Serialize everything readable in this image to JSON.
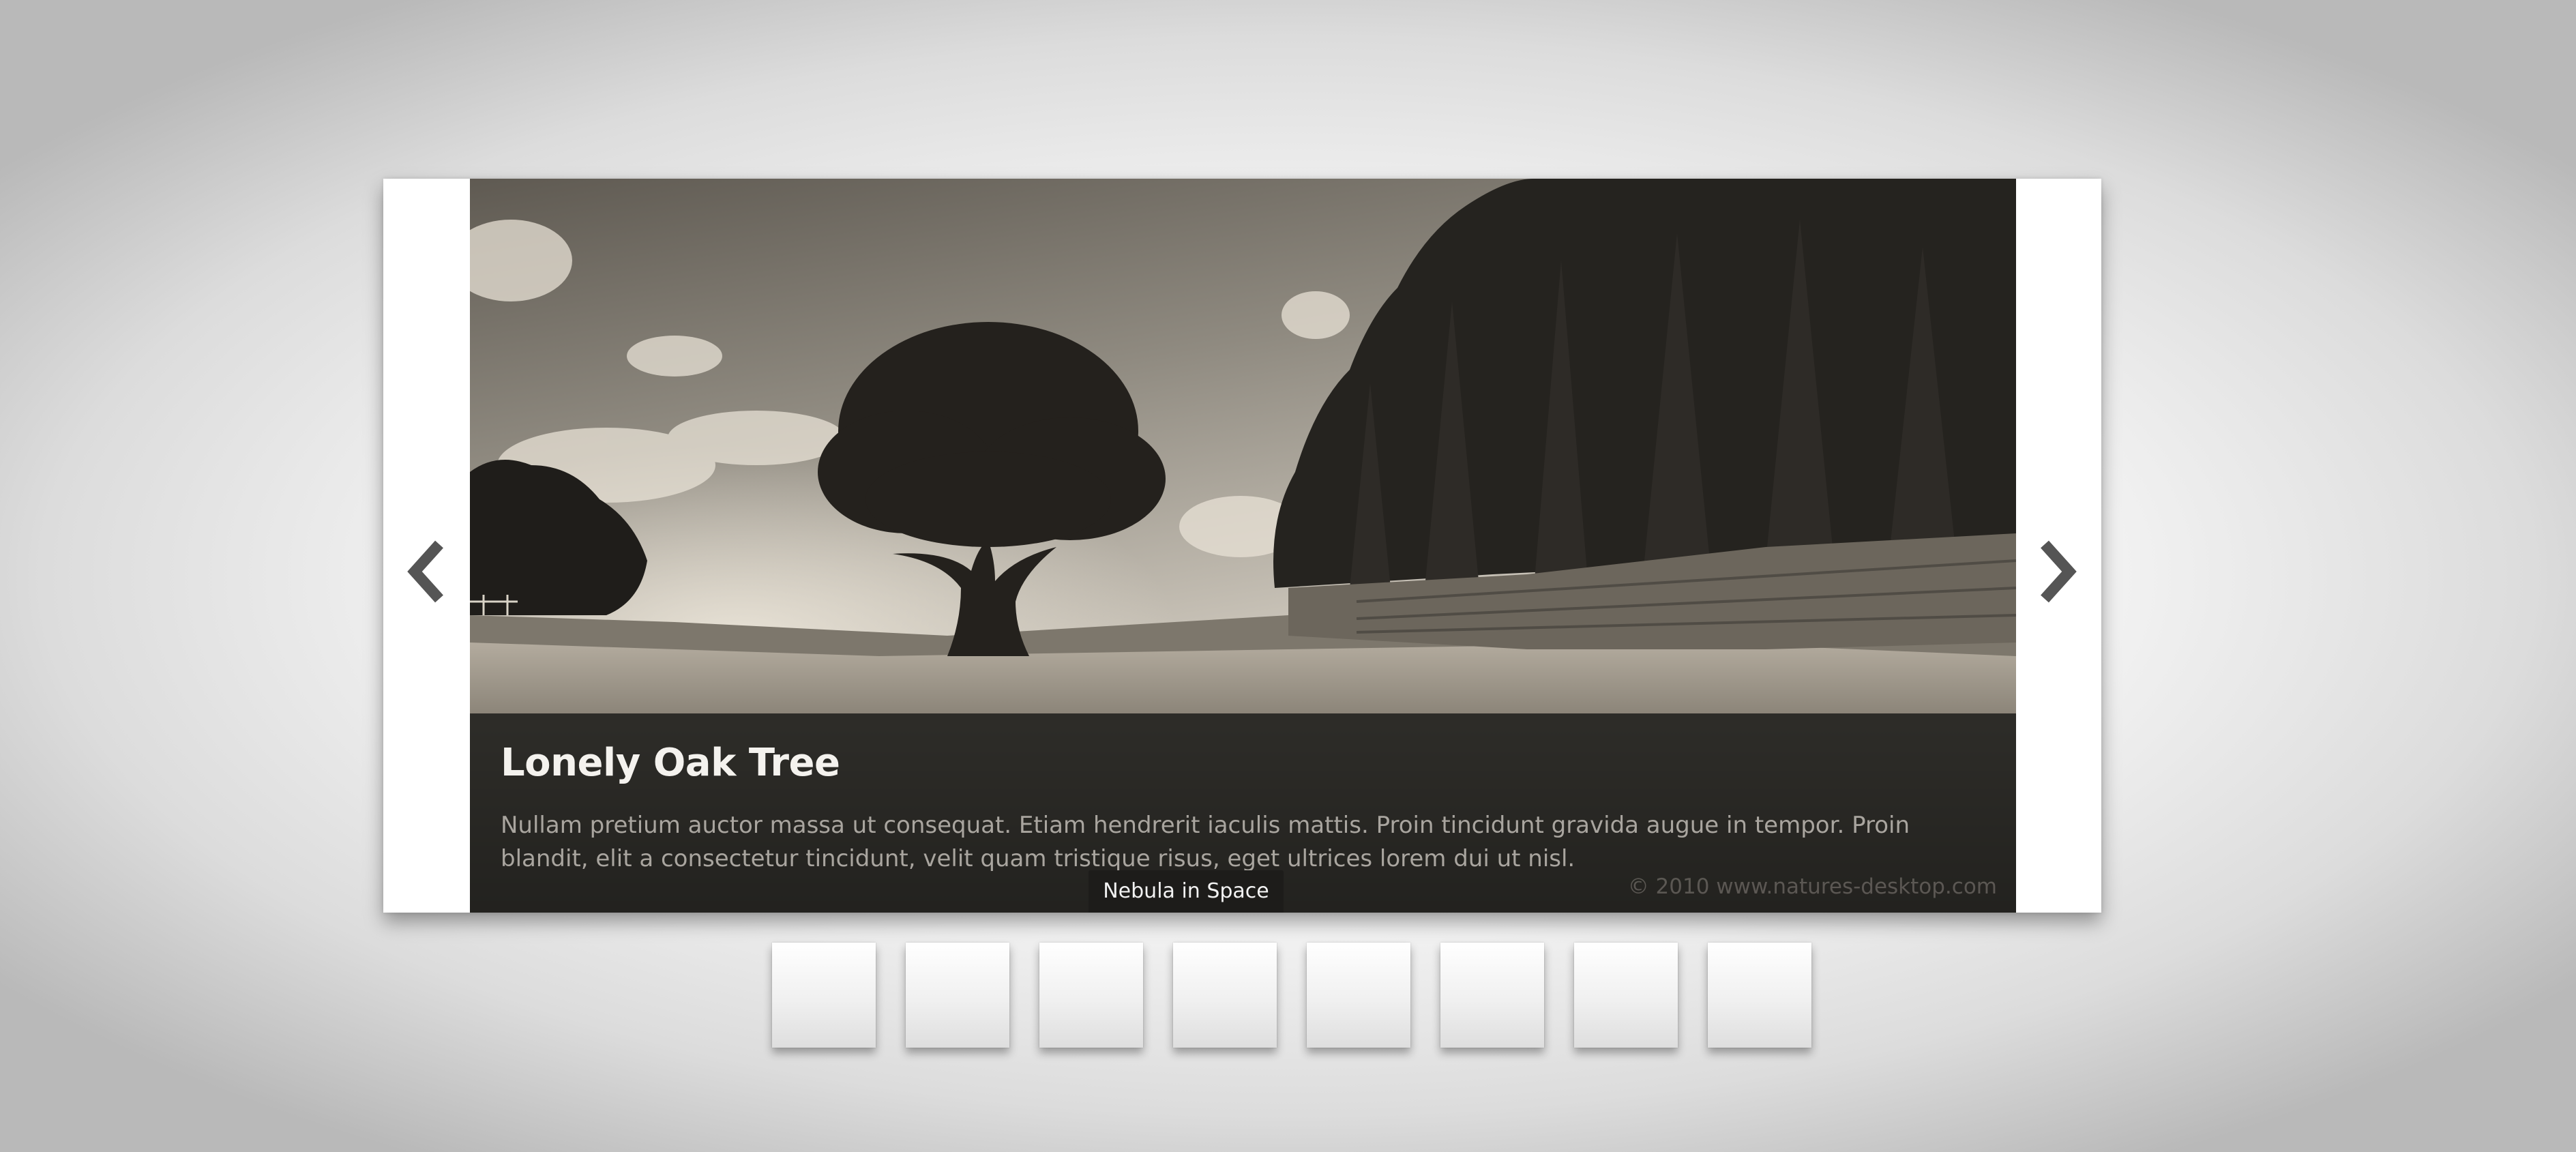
{
  "slider": {
    "caption": {
      "title": "Lonely Oak Tree",
      "text": "Nullam pretium auctor massa ut consequat. Etiam hendrerit iaculis mattis. Proin tincidunt gravida augue in tempor. Proin blandit, elit a consectetur tincidunt, velit quam tristique risus, eget ultrices lorem dui ut nisl.",
      "credit": "© 2010 www.natures-desktop.com"
    },
    "tooltip": "Nebula in Space",
    "prev_icon": "chevron-left-icon",
    "next_icon": "chevron-right-icon",
    "thumbnail_count": 8,
    "colors": {
      "caption_background": "#1c1b19",
      "frame": "#ffffff",
      "arrow": "#555555"
    }
  }
}
